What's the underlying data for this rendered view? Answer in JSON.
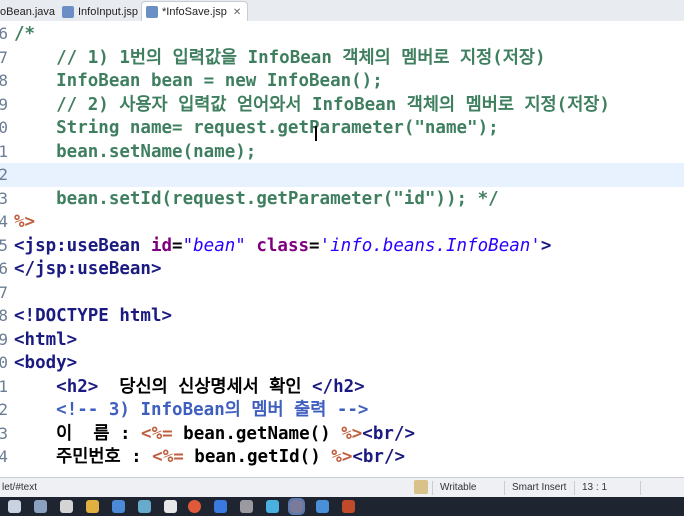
{
  "tabs": [
    {
      "label": "oBean.java",
      "icon": "java-file-icon",
      "active": false
    },
    {
      "label": "InfoInput.jsp",
      "icon": "jsp-file-icon",
      "active": false
    },
    {
      "label": "*InfoSave.jsp",
      "icon": "jsp-file-icon",
      "active": true
    }
  ],
  "editor": {
    "lines": [
      {
        "n": "6",
        "parts": [
          [
            "c-com",
            "/*"
          ]
        ]
      },
      {
        "n": "7",
        "parts": [
          [
            "c-com",
            "    // 1) 1번의 입력값을 InfoBean 객체의 멤버로 지정(저장)"
          ]
        ]
      },
      {
        "n": "8",
        "parts": [
          [
            "c-com",
            "    InfoBean bean = new InfoBean();"
          ]
        ]
      },
      {
        "n": "9",
        "parts": [
          [
            "c-com",
            "    // 2) 사용자 입력값 얻어와서 InfoBean 객체의 멤버로 지정(저장)"
          ]
        ]
      },
      {
        "n": "0",
        "parts": [
          [
            "c-com",
            "    String name= request.getParameter(\"name\");"
          ]
        ]
      },
      {
        "n": "1",
        "parts": [
          [
            "c-com",
            "    bean.setName(name);"
          ]
        ]
      },
      {
        "n": "2",
        "parts": [
          [
            "c-com",
            ""
          ]
        ],
        "highlight": true
      },
      {
        "n": "3",
        "parts": [
          [
            "c-com",
            "    bean.setId(request.getParameter(\"id\")); */"
          ]
        ]
      },
      {
        "n": "4",
        "parts": [
          [
            "c-jsp",
            "%>"
          ]
        ]
      },
      {
        "n": "5",
        "parts": [
          [
            "c-tag",
            "<jsp:useBean "
          ],
          [
            "c-attr",
            "id"
          ],
          [
            "c-txt",
            "="
          ],
          [
            "c-val",
            "\"bean\""
          ],
          [
            "c-txt",
            " "
          ],
          [
            "c-attr",
            "class"
          ],
          [
            "c-txt",
            "="
          ],
          [
            "c-val",
            "'info.beans.InfoBean'"
          ],
          [
            "c-tag",
            ">"
          ]
        ]
      },
      {
        "n": "6",
        "parts": [
          [
            "c-tag",
            "</jsp:useBean>"
          ]
        ]
      },
      {
        "n": "7",
        "parts": [
          [
            "c-txt",
            ""
          ]
        ]
      },
      {
        "n": "8",
        "parts": [
          [
            "c-tag",
            "<!DOCTYPE html>"
          ]
        ]
      },
      {
        "n": "9",
        "parts": [
          [
            "c-tag",
            "<html>"
          ]
        ]
      },
      {
        "n": "0",
        "parts": [
          [
            "c-tag",
            "<body>"
          ]
        ]
      },
      {
        "n": "1",
        "parts": [
          [
            "c-txt",
            "    "
          ],
          [
            "c-tag",
            "<h2>"
          ],
          [
            "c-txt",
            "  당신의 신상명세서 확인 "
          ],
          [
            "c-tag",
            "</h2>"
          ]
        ]
      },
      {
        "n": "2",
        "parts": [
          [
            "c-txt",
            "    "
          ],
          [
            "c-htmlcom",
            "<!-- 3) InfoBean의 멤버 출력 -->"
          ]
        ]
      },
      {
        "n": "3",
        "parts": [
          [
            "c-txt",
            "    이  름 : "
          ],
          [
            "c-jsp",
            "<%="
          ],
          [
            "c-txt",
            " bean.getName() "
          ],
          [
            "c-jsp",
            "%>"
          ],
          [
            "c-tag",
            "<br/>"
          ]
        ]
      },
      {
        "n": "4",
        "parts": [
          [
            "c-txt",
            "    주민번호 : "
          ],
          [
            "c-jsp",
            "<%="
          ],
          [
            "c-txt",
            " bean.getId() "
          ],
          [
            "c-jsp",
            "%>"
          ],
          [
            "c-tag",
            "<br/>"
          ]
        ]
      }
    ]
  },
  "status": {
    "path": "let/#text",
    "mode": "Writable",
    "insert": "Smart Insert",
    "position": "13 : 1"
  }
}
